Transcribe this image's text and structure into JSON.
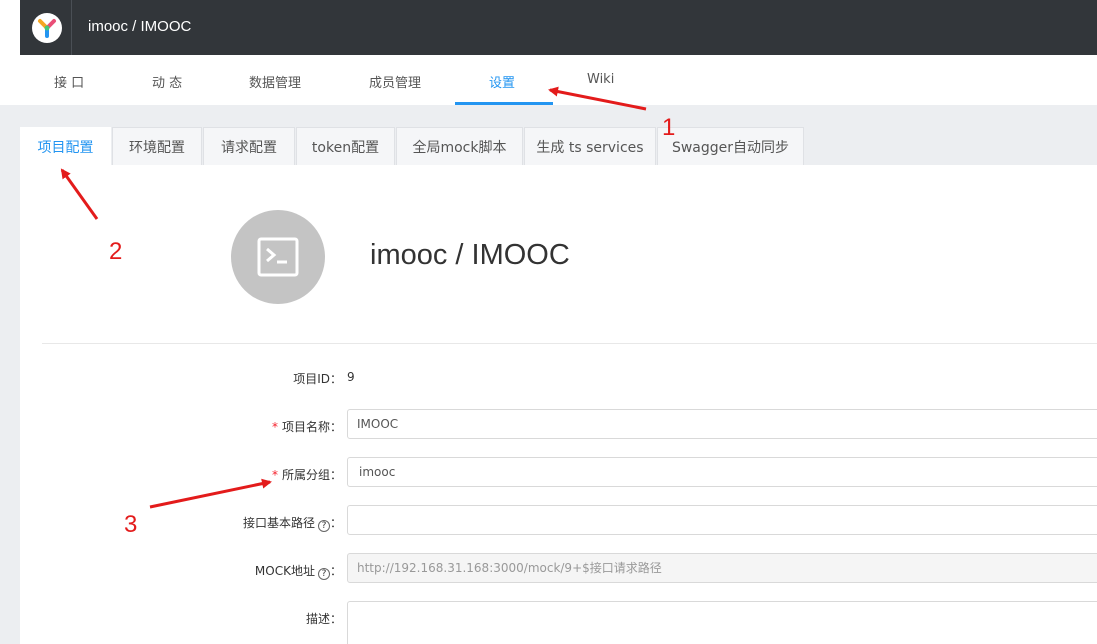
{
  "header": {
    "project_title": "imooc / IMOOC"
  },
  "nav": {
    "tabs": [
      "接 口",
      "动 态",
      "数据管理",
      "成员管理",
      "设置",
      "Wiki"
    ],
    "active": "设置"
  },
  "settings_tabs": {
    "items": [
      "项目配置",
      "环境配置",
      "请求配置",
      "token配置",
      "全局mock脚本",
      "生成 ts services",
      "Swagger自动同步"
    ],
    "active": "项目配置"
  },
  "project": {
    "title": "imooc / IMOOC"
  },
  "form": {
    "id_label": "项目ID：",
    "id_value": "9",
    "name_label": "项目名称：",
    "name_value": "IMOOC",
    "group_label": "所属分组：",
    "group_value": "imooc",
    "basepath_label": "接口基本路径",
    "basepath_value": "",
    "mock_label": "MOCK地址",
    "mock_value": "http://192.168.31.168:3000/mock/9+$接口请求路径",
    "desc_label": "描述：",
    "colon": "：",
    "required_mark": "*",
    "help_mark": "?"
  },
  "annotations": {
    "labels": [
      "1",
      "2",
      "3"
    ],
    "color": "#e31b1b"
  },
  "colors": {
    "header_bg": "#32363a",
    "accent": "#2395f1",
    "required": "#f5222d"
  }
}
